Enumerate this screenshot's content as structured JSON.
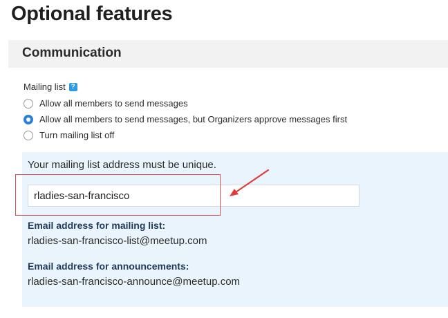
{
  "page": {
    "title": "Optional features"
  },
  "section": {
    "title": "Communication"
  },
  "mailing_list": {
    "label": "Mailing list",
    "help_glyph": "?",
    "options": [
      {
        "label": "Allow all members to send messages",
        "checked": false
      },
      {
        "label": "Allow all members to send messages, but Organizers approve messages first",
        "checked": true
      },
      {
        "label": "Turn mailing list off",
        "checked": false
      }
    ]
  },
  "address": {
    "instruction": "Your mailing list address must be unique.",
    "input_value": "rladies-san-francisco",
    "mailing_list_heading": "Email address for mailing list:",
    "mailing_list_value": "rladies-san-francisco-list@meetup.com",
    "announcements_heading": "Email address for announcements:",
    "announcements_value": "rladies-san-francisco-announce@meetup.com"
  },
  "annotation": {
    "color": "#e03c3c",
    "icon": "arrow-icon"
  },
  "colors": {
    "accent": "#2c7fd6",
    "info_background": "#eaf4fc",
    "section_background": "#f2f2f2"
  }
}
